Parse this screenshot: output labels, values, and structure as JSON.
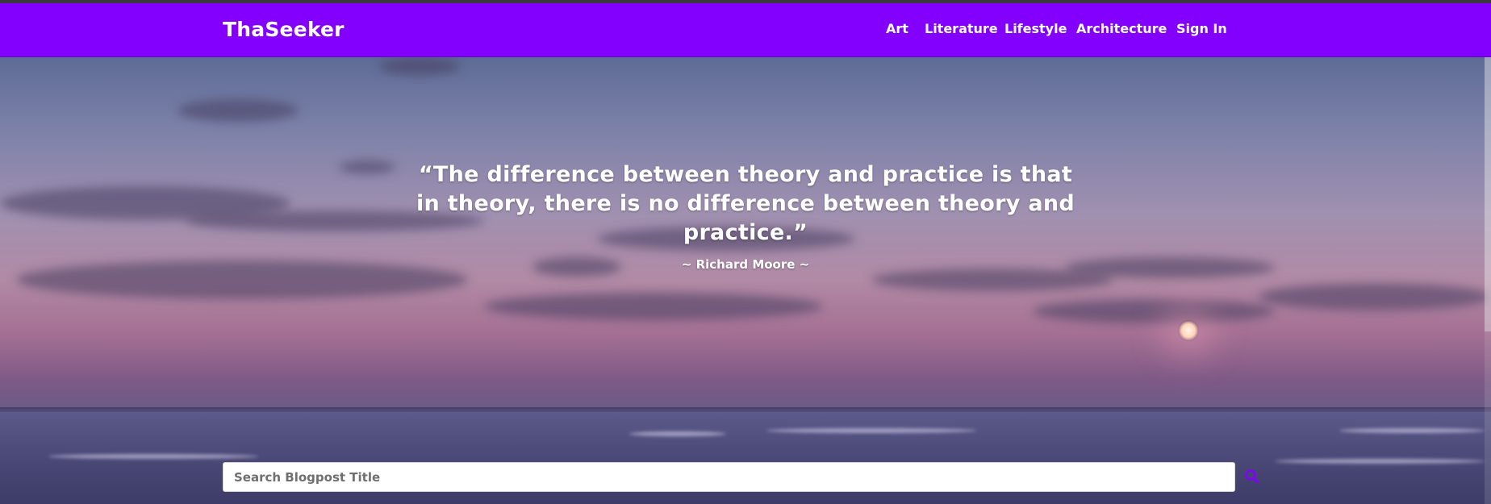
{
  "brand": {
    "name": "ThaSeeker"
  },
  "nav": {
    "links": [
      "Art",
      "Literature",
      "Lifestyle",
      "Architecture"
    ],
    "sign_in": "Sign In"
  },
  "hero": {
    "quote": "“The difference between theory and practice is that in theory, there is no difference between theory and practice.”",
    "author": "~ Richard Moore ~"
  },
  "search": {
    "placeholder": "Search Blogpost Title",
    "value": "",
    "icon": "search-icon"
  },
  "colors": {
    "navbar": "#8300ff",
    "accent": "#8300ff",
    "text_light": "#ffffff"
  }
}
